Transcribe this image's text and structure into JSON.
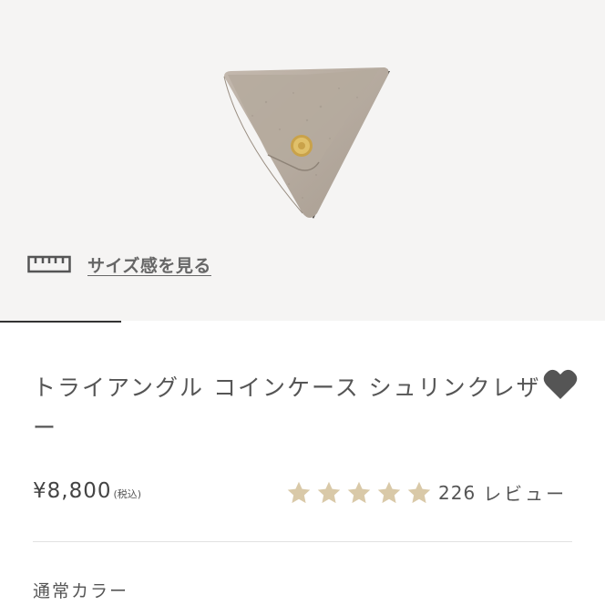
{
  "gallery": {
    "background_color": "#f5f4f3",
    "size_guide_label": "サイズ感を見る",
    "size_guide_icon": "ruler-icon",
    "image_progress": 0.2
  },
  "product": {
    "title": "トライアングル コインケース シュリンクレザー",
    "price": "¥8,800",
    "tax_note": "(税込)",
    "favorite_icon": "heart-icon",
    "rating": {
      "stars": 5,
      "count": "226",
      "label": "レビュー",
      "star_color": "#d9c9a8"
    },
    "color_section_label": "通常カラー"
  },
  "colors": {
    "leather": "#b8ada1",
    "accent_dark": "#555555"
  }
}
